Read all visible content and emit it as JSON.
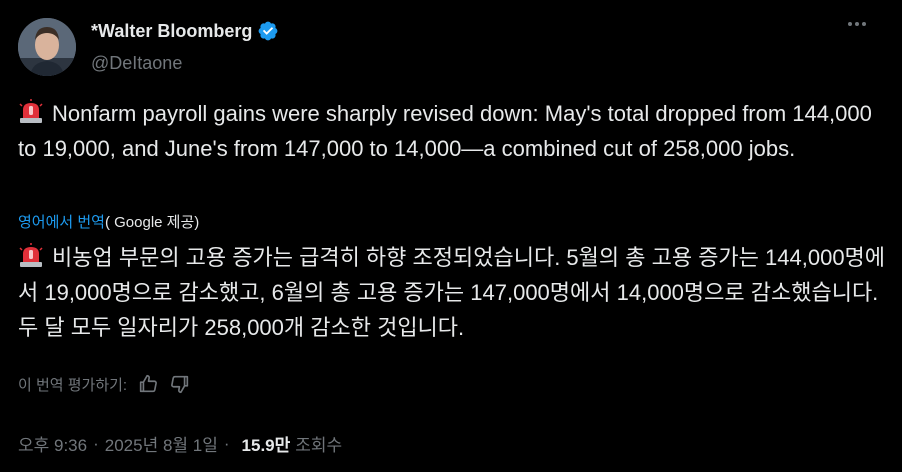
{
  "author": {
    "name": "*Walter Bloomberg",
    "handle": "@DeItaone"
  },
  "tweet": {
    "text": "Nonfarm payroll gains were sharply revised down: May's total dropped from 144,000 to 19,000, and June's from 147,000 to 14,000—a combined cut of 258,000 jobs."
  },
  "translation": {
    "link_label": "영어에서 번역",
    "provider_label": "( Google 제공)",
    "text": "비농업 부문의 고용 증가는 급격히 하향 조정되었습니다. 5월의 총 고용 증가는 144,000명에서 19,000명으로 감소했고, 6월의 총 고용 증가는 147,000명에서 14,000명으로 감소했습니다. 두 달 모두 일자리가 258,000개 감소한 것입니다.",
    "rate_label": "이 번역 평가하기:"
  },
  "meta": {
    "time": "오후 9:36",
    "date": "2025년 8월 1일",
    "views_count": "15.9만",
    "views_label": "조회수"
  },
  "icons": {
    "siren": "siren-emoji-icon",
    "verified": "verified-badge-icon",
    "more": "more-options-icon",
    "thumbs_up": "thumbs-up-icon",
    "thumbs_down": "thumbs-down-icon"
  },
  "colors": {
    "background": "#000000",
    "text": "#e7e9ea",
    "secondary": "#71767b",
    "link": "#1d9bf0",
    "siren_red": "#e0303a"
  }
}
